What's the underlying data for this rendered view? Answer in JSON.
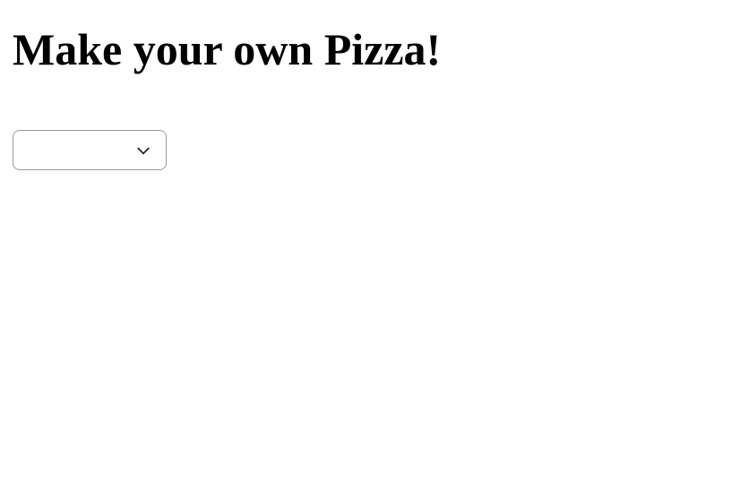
{
  "header": {
    "title": "Make your own Pizza!"
  },
  "form": {
    "dropdown": {
      "selected": ""
    }
  }
}
